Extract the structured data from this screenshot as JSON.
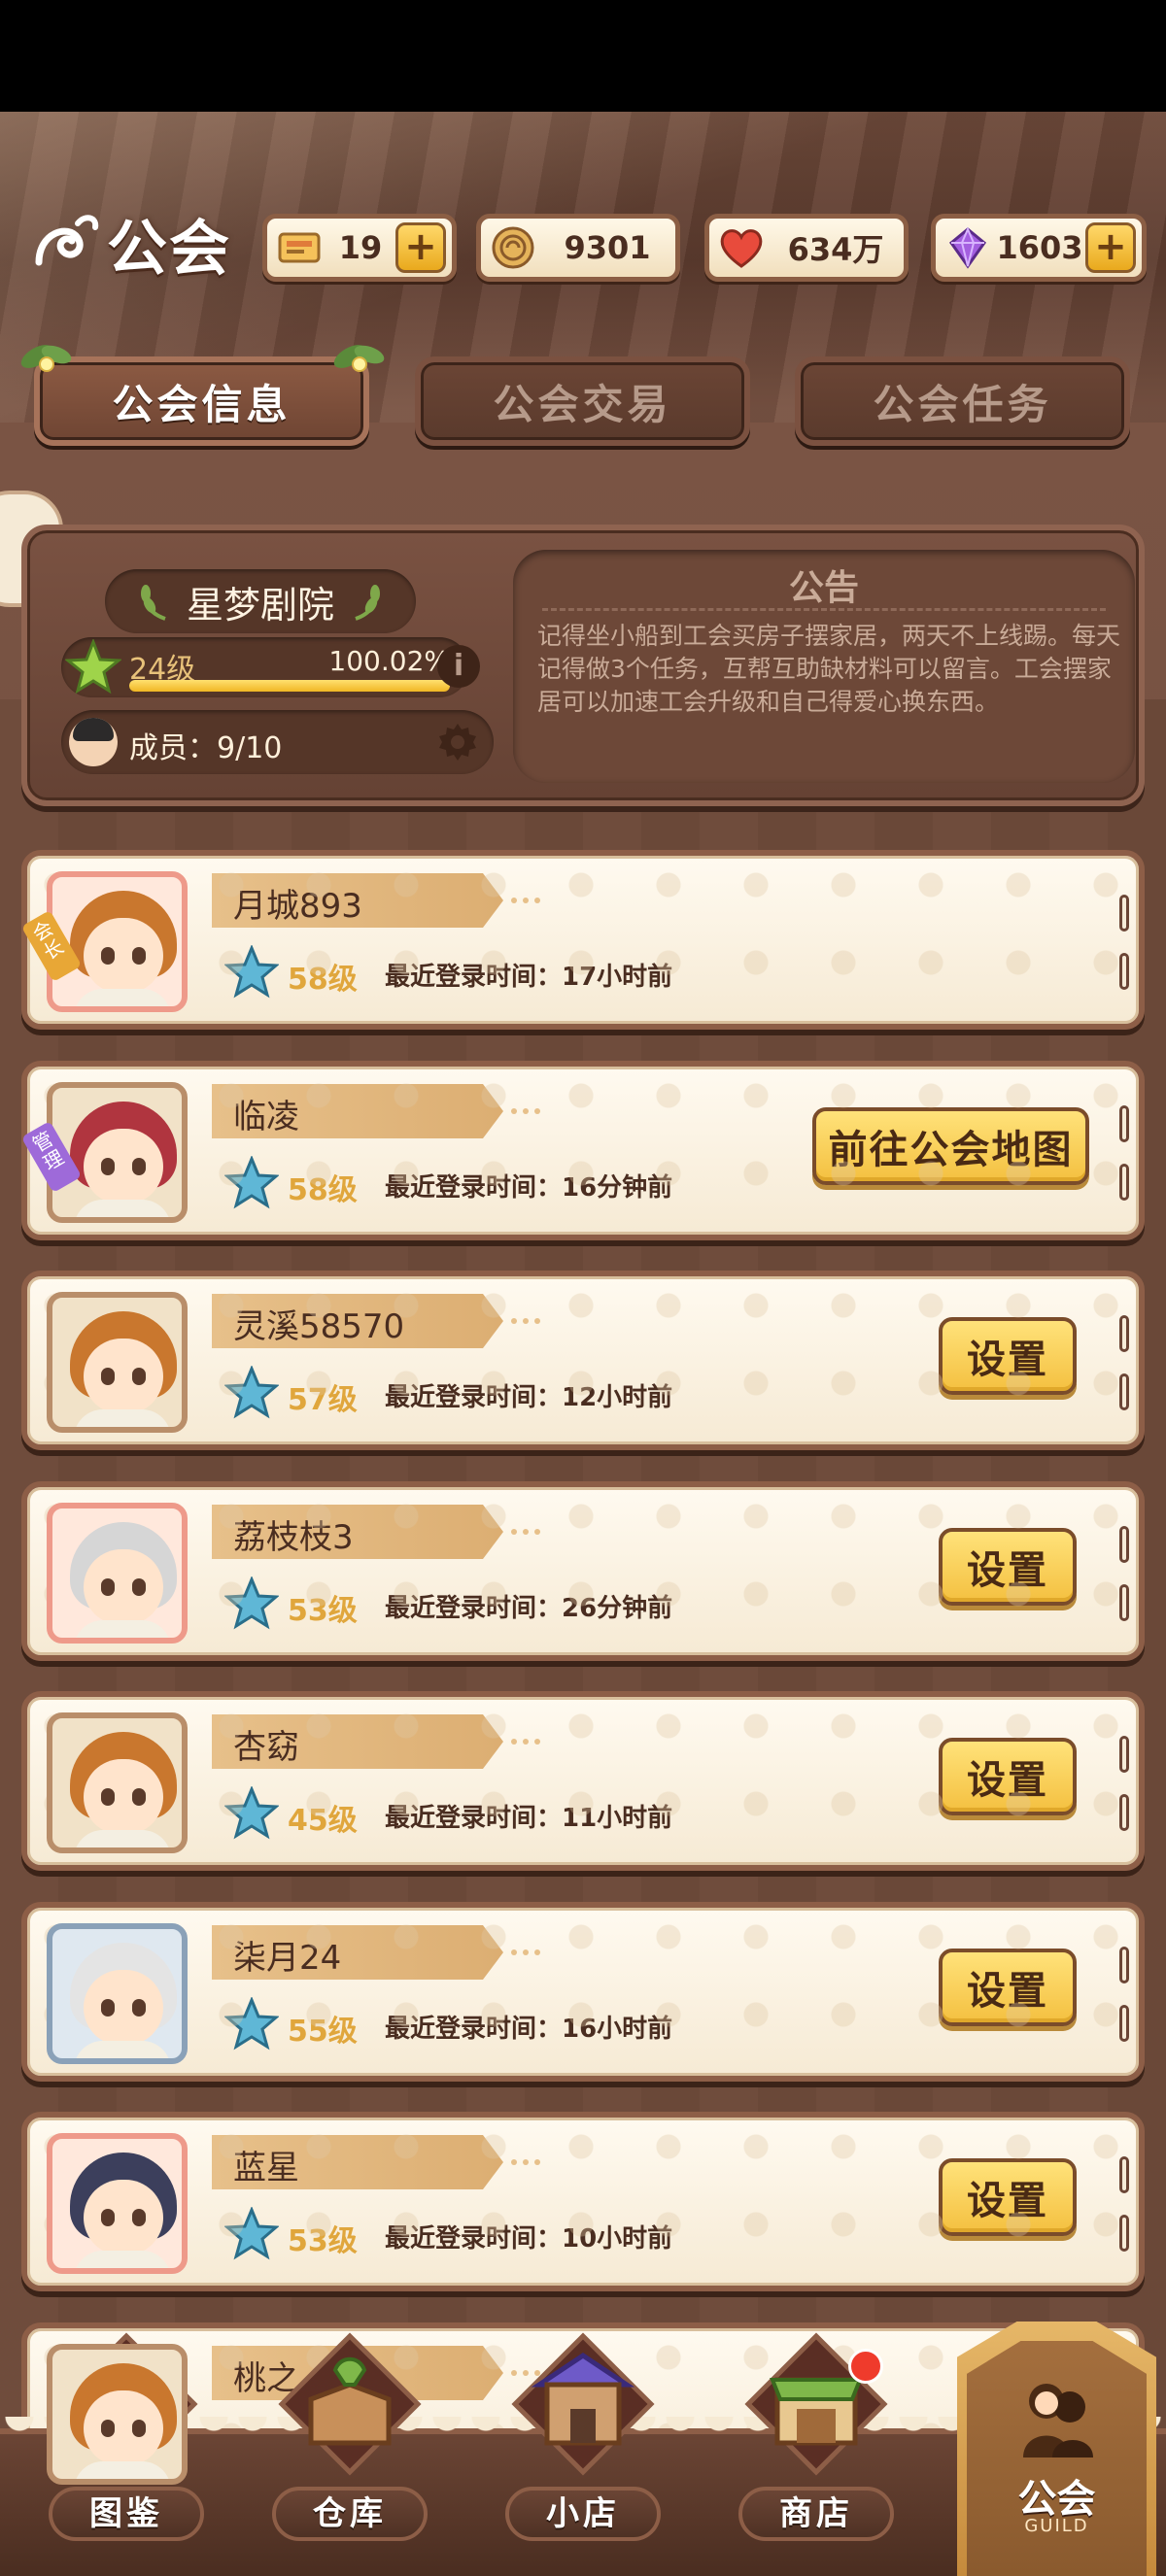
{
  "header": {
    "title": "公会",
    "resources": [
      {
        "name": "ticket",
        "value": "19",
        "has_plus": true
      },
      {
        "name": "coin",
        "value": "9301",
        "has_plus": false
      },
      {
        "name": "heart",
        "value": "634万",
        "has_plus": false
      },
      {
        "name": "gem",
        "value": "1603",
        "has_plus": true
      }
    ]
  },
  "tabs": [
    {
      "label": "公会信息",
      "active": true
    },
    {
      "label": "公会交易",
      "active": false
    },
    {
      "label": "公会任务",
      "active": false
    }
  ],
  "guild": {
    "name": "星梦剧院",
    "level": "24级",
    "progress_text": "100.02%",
    "progress": 1.0,
    "members_label": "成员：9/10"
  },
  "notice": {
    "title": "公告",
    "text": "记得坐小船到工会买房子摆家居，两天不上线踢。每天记得做3个任务，互帮互助缺材料可以留言。工会摆家居可以加速工会升级和自己得爱心换东西。"
  },
  "login_label_prefix": "最近登录时间：",
  "members": [
    {
      "name": "月城893",
      "level": "58级",
      "login": "最近登录时间：17小时前",
      "role": "会长",
      "button": "",
      "frame": "pink",
      "hair": "#c9772e"
    },
    {
      "name": "临凌",
      "level": "58级",
      "login": "最近登录时间：16分钟前",
      "role": "管理",
      "button": "前往公会地图",
      "frame": "brown",
      "hair": "#b0353f"
    },
    {
      "name": "灵溪58570",
      "level": "57级",
      "login": "最近登录时间：12小时前",
      "role": "",
      "button": "设置",
      "frame": "brown",
      "hair": "#c9772e"
    },
    {
      "name": "荔枝枝3",
      "level": "53级",
      "login": "最近登录时间：26分钟前",
      "role": "",
      "button": "设置",
      "frame": "pink",
      "hair": "#d6d6d6"
    },
    {
      "name": "杏窈",
      "level": "45级",
      "login": "最近登录时间：11小时前",
      "role": "",
      "button": "设置",
      "frame": "brown",
      "hair": "#c9772e"
    },
    {
      "name": "柒月24",
      "level": "55级",
      "login": "最近登录时间：16小时前",
      "role": "",
      "button": "设置",
      "frame": "blue",
      "hair": "#e4e4e4"
    },
    {
      "name": "蓝星",
      "level": "53级",
      "login": "最近登录时间：10小时前",
      "role": "",
      "button": "设置",
      "frame": "pink",
      "hair": "#3c3f5c"
    },
    {
      "name": "桃之",
      "level": "",
      "login": "",
      "role": "",
      "button": "",
      "frame": "brown",
      "hair": "#c9772e"
    }
  ],
  "bottom_nav": [
    {
      "label": "图鉴",
      "icon": "book-icon"
    },
    {
      "label": "仓库",
      "icon": "warehouse-box-icon"
    },
    {
      "label": "小店",
      "icon": "small-shop-icon"
    },
    {
      "label": "商店",
      "icon": "store-icon"
    }
  ],
  "guild_tab": {
    "label": "公会",
    "sub": "GUILD"
  },
  "colors": {
    "accent_gold": "#f4c040",
    "wood_dark": "#5a3a2c",
    "star_blue": "#5fb7d6",
    "level_gold": "#e0a63c"
  }
}
